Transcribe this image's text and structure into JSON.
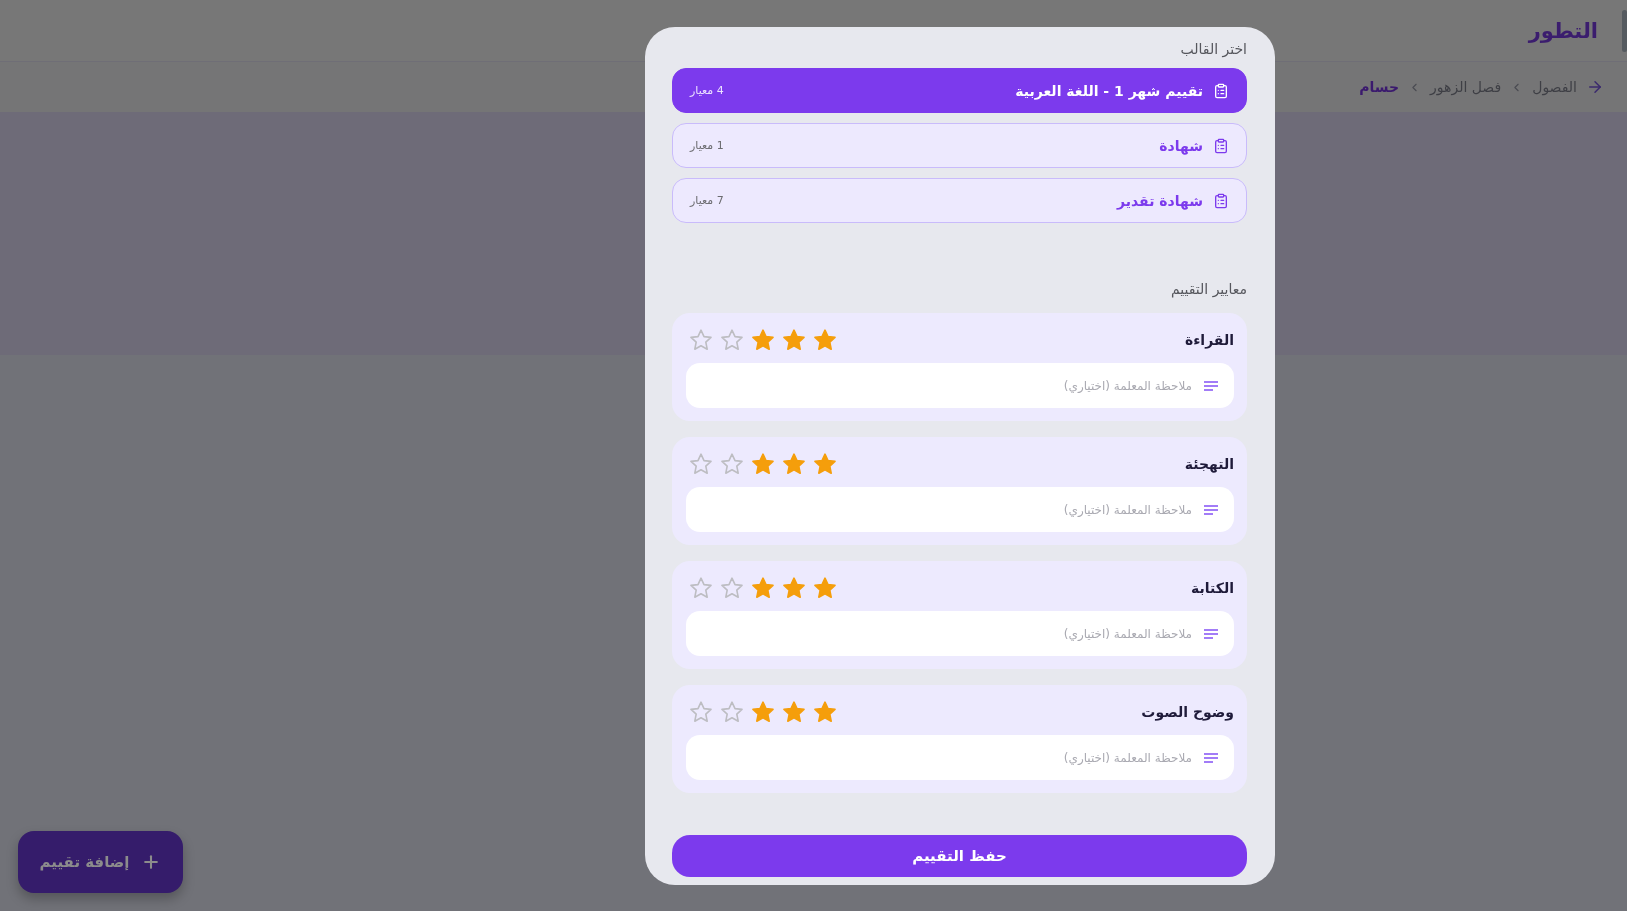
{
  "header": {
    "title": "التطور"
  },
  "breadcrumb": {
    "items": [
      {
        "label": "الفصول",
        "current": false
      },
      {
        "label": "فصل الزهور",
        "current": false
      },
      {
        "label": "حسام",
        "current": true
      }
    ]
  },
  "add_button": {
    "label": "إضافة تقييم"
  },
  "dialog": {
    "template_label": "اختر القالب",
    "templates": [
      {
        "name": "تقييم شهر 1 - اللغة العربية",
        "count": "4 معيار",
        "selected": true
      },
      {
        "name": "شهادة",
        "count": "1 معيار",
        "selected": false
      },
      {
        "name": "شهادة تقدير",
        "count": "7 معيار",
        "selected": false
      }
    ],
    "criteria_label": "معايير التقييم",
    "criteria": [
      {
        "name": "القراءة",
        "stars": 3,
        "note": {
          "placeholder": "ملاحظة المعلمة (اختياري)"
        }
      },
      {
        "name": "التهجئة",
        "stars": 3,
        "note": {
          "placeholder": "ملاحظة المعلمة (اختياري)"
        }
      },
      {
        "name": "الكتابة",
        "stars": 3,
        "note": {
          "placeholder": "ملاحظة المعلمة (اختياري)"
        }
      },
      {
        "name": "وضوح الصوت",
        "stars": 3,
        "note": {
          "placeholder": "ملاحظة المعلمة (اختياري)"
        }
      }
    ],
    "save_button": "حفظ التقييم"
  }
}
